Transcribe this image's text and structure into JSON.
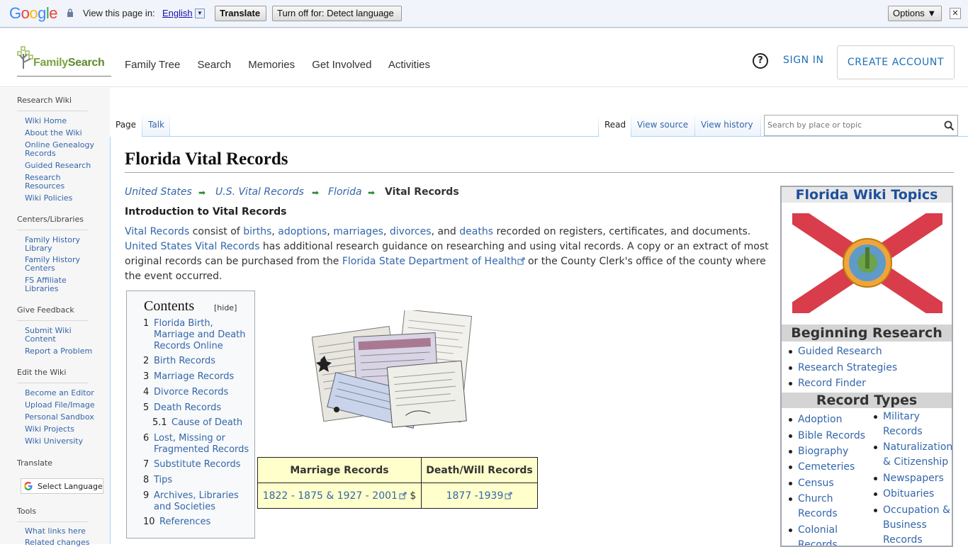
{
  "translate_bar": {
    "logo": "Google",
    "view_text": "View this page in:",
    "language": "English",
    "translate_label": "Translate",
    "turn_off_label": "Turn off for: Detect language",
    "options_label": "Options ▼",
    "close_label": "✕"
  },
  "header": {
    "logo_text_a": "Family",
    "logo_text_b": "Search",
    "nav": [
      "Family Tree",
      "Search",
      "Memories",
      "Get Involved",
      "Activities"
    ],
    "help_label": "?",
    "sign_in": "SIGN IN",
    "create_account": "CREATE ACCOUNT"
  },
  "sidebar": {
    "research_wiki": "Research Wiki",
    "research_items": [
      "Wiki Home",
      "About the Wiki",
      "Online Genealogy Records",
      "Guided Research",
      "Research Resources",
      "Wiki Policies"
    ],
    "centers": "Centers/Libraries",
    "centers_items": [
      "Family History Library",
      "Family History Centers",
      "FS Affiliate Libraries"
    ],
    "feedback": "Give Feedback",
    "feedback_items": [
      "Submit Wiki Content",
      "Report a Problem"
    ],
    "edit": "Edit the Wiki",
    "edit_items": [
      "Become an Editor",
      "Upload File/Image",
      "Personal Sandbox",
      "Wiki Projects",
      "Wiki University"
    ],
    "translate": "Translate",
    "select_language": "Select Language",
    "tools": "Tools",
    "tools_items": [
      "What links here",
      "Related changes"
    ]
  },
  "tabs": {
    "page": "Page",
    "talk": "Talk",
    "read": "Read",
    "view_source": "View source",
    "view_history": "View history",
    "search_placeholder": "Search by place or topic"
  },
  "article": {
    "title": "Florida Vital Records",
    "breadcrumb": [
      "United States",
      "U.S. Vital Records",
      "Florida"
    ],
    "breadcrumb_current": "Vital Records",
    "intro_heading": "Introduction to Vital Records",
    "p_vital": "Vital Records",
    "p_consist": " consist of ",
    "p_births": "births",
    "p_c1": ", ",
    "p_adoptions": "adoptions",
    "p_c2": ", ",
    "p_marriages": "marriages",
    "p_c3": ", ",
    "p_divorces": "divorces",
    "p_and": ", and ",
    "p_deaths": "deaths",
    "p_rest1": " recorded on registers, certificates, and documents.",
    "p_usvr": "United States Vital Records",
    "p_rest2": " has additional research guidance on researching and using vital records. A copy or an extract of most original records can be purchased from the ",
    "p_fsdh": "Florida State Department of Health",
    "p_rest3": " or the County Clerk's office of the county where the event occurred."
  },
  "toc": {
    "title": "Contents",
    "hide": "[hide]",
    "items": [
      {
        "num": "1",
        "text": "Florida Birth, Marriage and Death Records Online"
      },
      {
        "num": "2",
        "text": "Birth Records"
      },
      {
        "num": "3",
        "text": "Marriage Records"
      },
      {
        "num": "4",
        "text": "Divorce Records"
      },
      {
        "num": "5",
        "text": "Death Records"
      },
      {
        "num": "5.1",
        "text": "Cause of Death"
      },
      {
        "num": "6",
        "text": "Lost, Missing or Fragmented Records"
      },
      {
        "num": "7",
        "text": "Substitute Records"
      },
      {
        "num": "8",
        "text": "Tips"
      },
      {
        "num": "9",
        "text": "Archives, Libraries and Societies"
      },
      {
        "num": "10",
        "text": "References"
      }
    ]
  },
  "records_table": {
    "headers": [
      "Marriage Records",
      "Death/Will Records"
    ],
    "marriage_range": "1822 - 1875 & 1927 - 2001",
    "dollar": "$",
    "death_range": "1877 -1939"
  },
  "right_box": {
    "title": "Florida Wiki Topics",
    "beginning": "Beginning Research",
    "beginning_items": [
      "Guided Research",
      "Research Strategies",
      "Record Finder"
    ],
    "record_types": "Record Types",
    "col1": [
      "Adoption",
      "Bible Records",
      "Biography",
      "Cemeteries",
      "Census",
      "Church Records",
      "Colonial Records"
    ],
    "col2": [
      "Military Records",
      "Naturalization & Citizenship",
      "Newspapers",
      "Obituaries",
      "Occupation & Business Records"
    ]
  }
}
